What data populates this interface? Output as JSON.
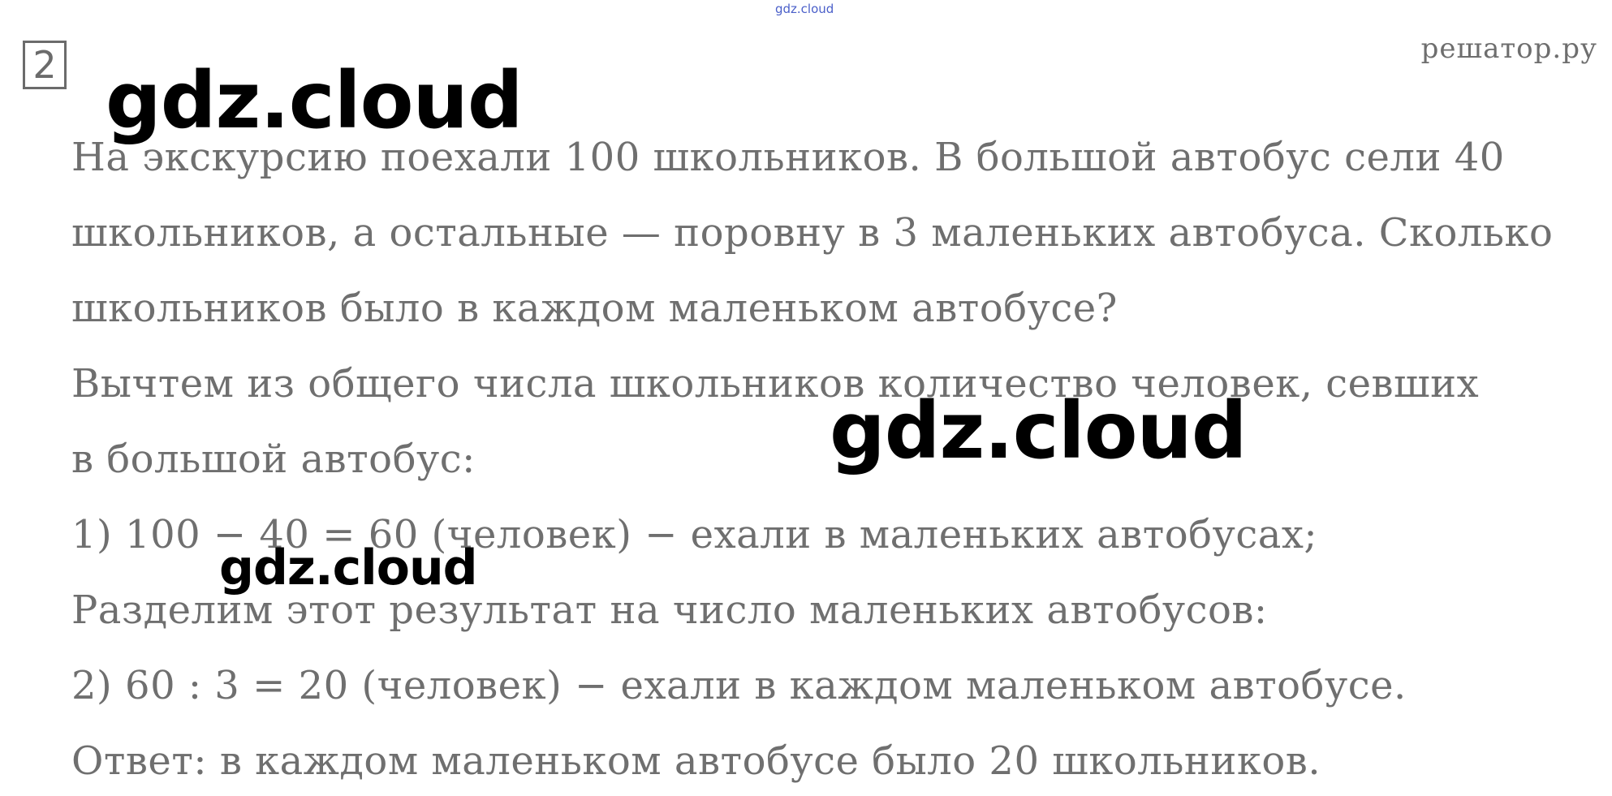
{
  "header": {
    "top_watermark": "gdz.cloud",
    "task_number": "2",
    "site_label": "решатор.ру"
  },
  "watermarks": {
    "primary": "gdz.cloud",
    "middle": "gdz.cloud",
    "small": "gdz.cloud"
  },
  "problem": {
    "lines": [
      "На экскурсию поехали 100 школьников. В большой автобус сели 40",
      "школьников, а остальные —  поровну в 3 маленьких автобуса. Сколько",
      "школьников было в каждом маленьком автобусе?"
    ]
  },
  "solution": {
    "intro_lines": [
      "Вычтем из общего числа школьников количество человек, севших",
      "в большой автобус:"
    ],
    "step1": "1) 100 − 40 = 60 (человек) − ехали в маленьких автобусах;",
    "step2_intro": "Разделим этот результат на число маленьких автобусов:",
    "step2": "2) 60 : 3 = 20 (человек) − ехали в каждом маленьком автобусе.",
    "answer": "Ответ: в каждом маленьком автобусе было 20 школьников."
  }
}
